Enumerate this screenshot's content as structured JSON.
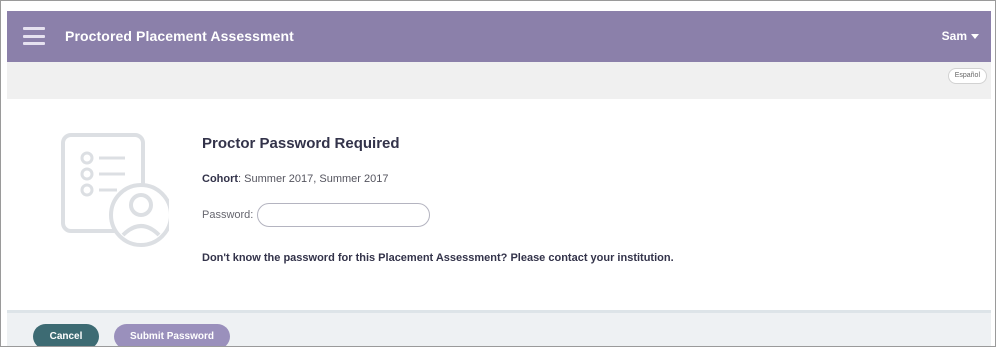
{
  "header": {
    "title": "Proctored Placement Assessment",
    "user_name": "Sam",
    "menu_icon": "hamburger-menu-icon",
    "caret_icon": "caret-down-icon",
    "color": "#8b80aa"
  },
  "subbar": {
    "language_label": "Español"
  },
  "illustration": {
    "icon": "checklist-user-icon"
  },
  "main": {
    "heading": "Proctor Password Required",
    "cohort_label": "Cohort",
    "cohort_value": "Summer 2017, Summer 2017",
    "password_label": "Password",
    "password_value": "",
    "help_text": "Don't know the password for this Placement Assessment? Please contact your institution."
  },
  "footer": {
    "cancel_label": "Cancel",
    "submit_label": "Submit Password",
    "cancel_color": "#3d6b73",
    "submit_color": "#9a90bc"
  }
}
